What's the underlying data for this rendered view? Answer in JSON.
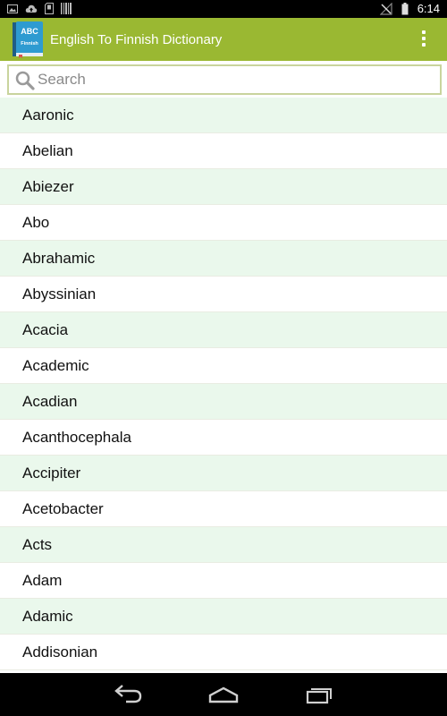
{
  "status_bar": {
    "time": "6:14",
    "left_icons": [
      "image-icon",
      "cloud-upload-icon",
      "sd-card-icon",
      "barcode-icon"
    ],
    "right_icons": [
      "no-signal-icon",
      "battery-icon"
    ]
  },
  "app_bar": {
    "title": "English To Finnish Dictionary",
    "icon_text_top": "ABC",
    "icon_text_bottom": "Finnish",
    "background": "#9ab832"
  },
  "search": {
    "placeholder": "Search",
    "value": ""
  },
  "words": [
    "Aaronic",
    "Abelian",
    "Abiezer",
    "Abo",
    "Abrahamic",
    "Abyssinian",
    "Acacia",
    "Academic",
    "Acadian",
    "Acanthocephala",
    "Accipiter",
    "Acetobacter",
    "Acts",
    "Adam",
    "Adamic",
    "Addisonian"
  ],
  "colors": {
    "row_alt": "#eaf8ec",
    "search_border": "#c9d49d"
  },
  "nav_bar": {
    "buttons": [
      "back-icon",
      "home-icon",
      "recent-apps-icon"
    ]
  }
}
